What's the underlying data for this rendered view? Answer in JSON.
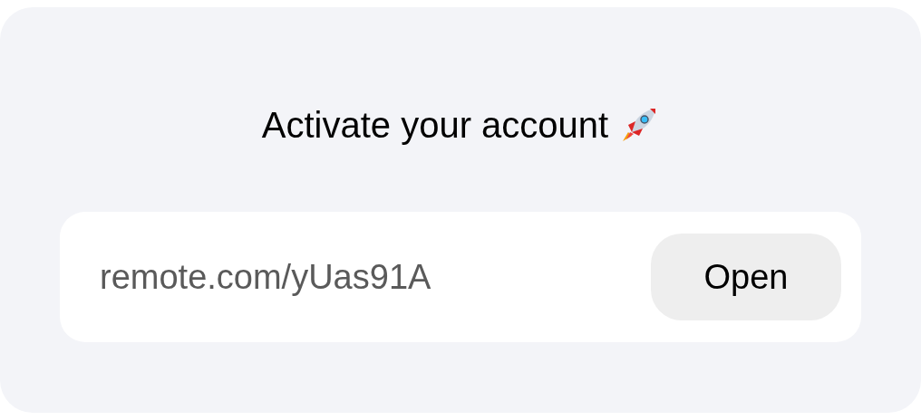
{
  "title": "Activate your account",
  "link": "remote.com/yUas91A",
  "button": "Open"
}
